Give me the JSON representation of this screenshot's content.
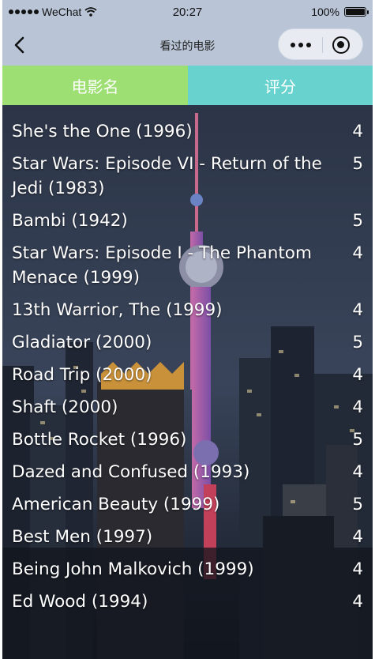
{
  "status_bar": {
    "carrier": "WeChat",
    "time": "20:27",
    "battery": "100%"
  },
  "nav": {
    "title": "看过的电影"
  },
  "tabs": {
    "name_label": "电影名",
    "score_label": "评分"
  },
  "colors": {
    "name_tab": "#9ddf73",
    "score_tab": "#68d2ce",
    "nav_bg": "#b9c5d7"
  },
  "movies": [
    {
      "title": "She's the One (1996)",
      "score": "4"
    },
    {
      "title": "Star Wars: Episode VI - Return of the Jedi (1983)",
      "score": "5"
    },
    {
      "title": "Bambi (1942)",
      "score": "5"
    },
    {
      "title": "Star Wars: Episode I - The Phantom Menace (1999)",
      "score": "4"
    },
    {
      "title": "13th Warrior, The (1999)",
      "score": "4"
    },
    {
      "title": "Gladiator (2000)",
      "score": "5"
    },
    {
      "title": "Road Trip (2000)",
      "score": "4"
    },
    {
      "title": "Shaft (2000)",
      "score": "4"
    },
    {
      "title": "Bottle Rocket (1996)",
      "score": "5"
    },
    {
      "title": "Dazed and Confused (1993)",
      "score": "4"
    },
    {
      "title": "American Beauty (1999)",
      "score": "5"
    },
    {
      "title": "Best Men (1997)",
      "score": "4"
    },
    {
      "title": "Being John Malkovich (1999)",
      "score": "4"
    },
    {
      "title": "Ed Wood (1994)",
      "score": "4"
    }
  ]
}
